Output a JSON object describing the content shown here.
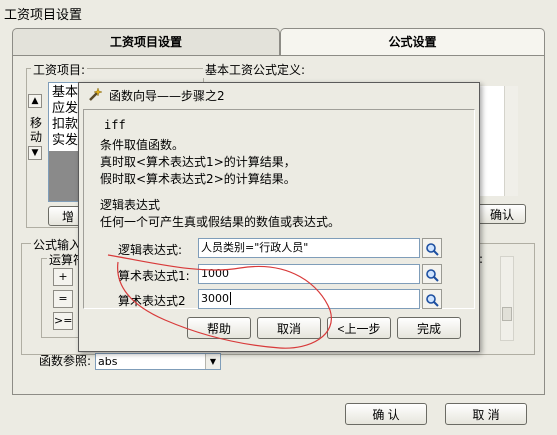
{
  "window": {
    "title": "工资项目设置"
  },
  "tabs": [
    {
      "label": "工资项目设置"
    },
    {
      "label": "公式设置"
    }
  ],
  "left_panel": {
    "items_label": "工资项目:",
    "move_label_1": "移",
    "move_label_2": "动",
    "items": [
      "基本",
      "应发",
      "扣款",
      "实发"
    ],
    "add_button": "增"
  },
  "right_panel": {
    "label": "基本工资公式定义:",
    "confirm_partial": "确认",
    "colon": ":"
  },
  "formula_input": {
    "label": "公式输入",
    "operators_label": "运算符",
    "op_plus": "+",
    "op_eq": "=",
    "op_ge": ">="
  },
  "function_ref": {
    "label": "函数参照:",
    "value": "abs"
  },
  "footer": {
    "ok": "确 认",
    "cancel": "取 消"
  },
  "dialog": {
    "title": "函数向导——步骤之2",
    "func_name": "iff",
    "desc1": "条件取值函数。",
    "desc2": "真时取<算术表达式1>的计算结果，",
    "desc3": "假时取<算术表达式2>的计算结果。",
    "section_title": "逻辑表达式",
    "section_desc": "任何一个可产生真或假结果的数值或表达式。",
    "fields": {
      "logic_label": "逻辑表达式",
      "logic_value": "人员类别=\"行政人员\"",
      "expr1_label": "算术表达式1",
      "expr1_value": "1000",
      "expr2_label": "算术表达式2",
      "expr2_value": "3000"
    },
    "buttons": {
      "help": "帮助",
      "cancel": "取消",
      "prev": "<上一步",
      "finish": "完成"
    }
  }
}
